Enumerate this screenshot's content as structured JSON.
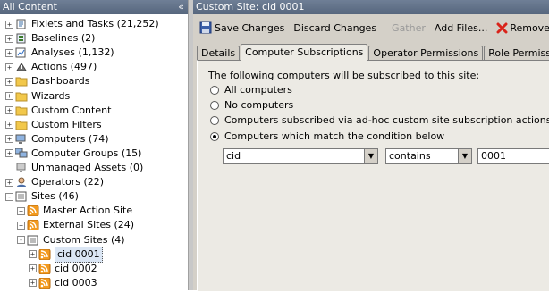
{
  "left_panel": {
    "title": "All Content",
    "collapse_glyph": "«",
    "tree": [
      {
        "label": "Fixlets and Tasks (21,252)",
        "icon": "fixlet-icon",
        "level": 0,
        "expander": "+"
      },
      {
        "label": "Baselines (2)",
        "icon": "baseline-icon",
        "level": 0,
        "expander": "+"
      },
      {
        "label": "Analyses (1,132)",
        "icon": "analysis-icon",
        "level": 0,
        "expander": "+"
      },
      {
        "label": "Actions (497)",
        "icon": "action-icon",
        "level": 0,
        "expander": "+"
      },
      {
        "label": "Dashboards",
        "icon": "folder-icon",
        "level": 0,
        "expander": "+"
      },
      {
        "label": "Wizards",
        "icon": "folder-icon",
        "level": 0,
        "expander": "+"
      },
      {
        "label": "Custom Content",
        "icon": "folder-icon",
        "level": 0,
        "expander": "+"
      },
      {
        "label": "Custom Filters",
        "icon": "folder-icon",
        "level": 0,
        "expander": "+"
      },
      {
        "label": "Computers (74)",
        "icon": "computer-icon",
        "level": 0,
        "expander": "+"
      },
      {
        "label": "Computer Groups (15)",
        "icon": "computer-group-icon",
        "level": 0,
        "expander": "+"
      },
      {
        "label": "Unmanaged Assets (0)",
        "icon": "unmanaged-asset-icon",
        "level": 0,
        "expander": ""
      },
      {
        "label": "Operators (22)",
        "icon": "operator-icon",
        "level": 0,
        "expander": "+"
      },
      {
        "label": "Sites (46)",
        "icon": "sites-icon",
        "level": 0,
        "expander": "-"
      },
      {
        "label": "Master Action Site",
        "icon": "site-icon",
        "level": 1,
        "expander": "+"
      },
      {
        "label": "External Sites (24)",
        "icon": "site-icon",
        "level": 1,
        "expander": "+"
      },
      {
        "label": "Custom Sites (4)",
        "icon": "sites-icon",
        "level": 1,
        "expander": "-"
      },
      {
        "label": "cid 0001",
        "icon": "site-icon",
        "level": 2,
        "expander": "+",
        "selected": true
      },
      {
        "label": "cid 0002",
        "icon": "site-icon",
        "level": 2,
        "expander": "+"
      },
      {
        "label": "cid 0003",
        "icon": "site-icon",
        "level": 2,
        "expander": "+"
      }
    ]
  },
  "right_panel": {
    "title": "Custom Site: cid 0001",
    "toolbar": {
      "save_label": "Save Changes",
      "discard_label": "Discard Changes",
      "gather_label": "Gather",
      "add_files_label": "Add Files...",
      "remove_label": "Remove"
    },
    "tabs": [
      "Details",
      "Computer Subscriptions",
      "Operator Permissions",
      "Role Permissions"
    ],
    "active_tab": "Computer Subscriptions",
    "subscription": {
      "description": "The following computers will be subscribed to this site:",
      "options": [
        {
          "label": "All computers",
          "checked": false
        },
        {
          "label": "No computers",
          "checked": false
        },
        {
          "label": "Computers subscribed via ad-hoc custom site subscription actions",
          "checked": false
        },
        {
          "label": "Computers which match the condition below",
          "checked": true
        }
      ],
      "condition": {
        "property": "cid",
        "operator": "contains",
        "value": "0001"
      }
    }
  },
  "colors": {
    "header_bg": "#5f6f86",
    "selection": "#3a6ea5",
    "panel_bg": "#d4d0c8",
    "content_bg": "#eceae4",
    "remove_red": "#d9231a",
    "folder_yellow": "#f2c84b",
    "rss_orange": "#f39a1e"
  }
}
